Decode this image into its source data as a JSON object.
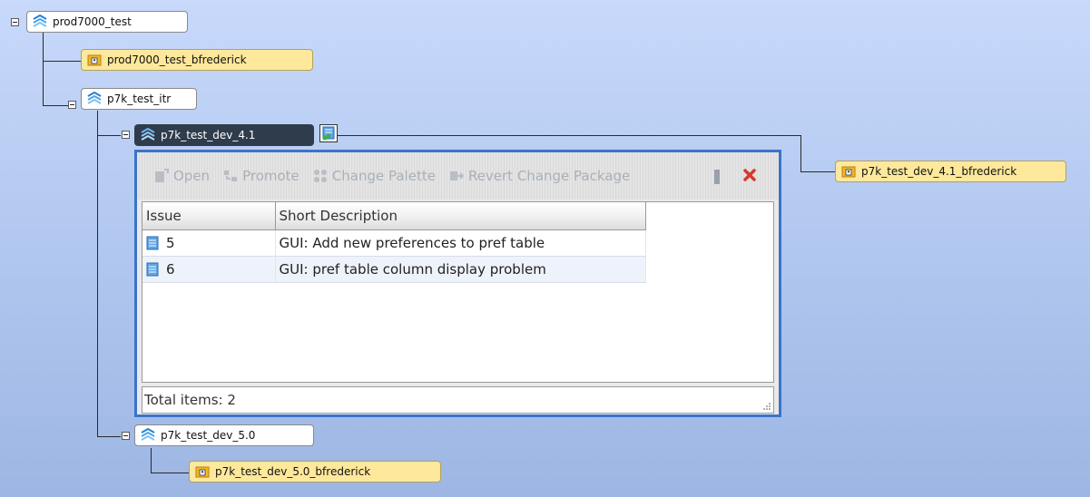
{
  "tree": {
    "nodes": [
      {
        "id": "prod7000_test",
        "label": "prod7000_test",
        "type": "stream"
      },
      {
        "id": "prod7000_test_bfrederick",
        "label": "prod7000_test_bfrederick",
        "type": "sandbox"
      },
      {
        "id": "p7k_test_itr",
        "label": "p7k_test_itr",
        "type": "stream"
      },
      {
        "id": "p7k_test_dev_4.1",
        "label": "p7k_test_dev_4.1",
        "type": "stream",
        "selected": true
      },
      {
        "id": "p7k_test_dev_4.1_bfrederick",
        "label": "p7k_test_dev_4.1_bfrederick",
        "type": "sandbox"
      },
      {
        "id": "p7k_test_dev_5.0",
        "label": "p7k_test_dev_5.0",
        "type": "stream"
      },
      {
        "id": "p7k_test_dev_5.0_bfrederick",
        "label": "p7k_test_dev_5.0_bfrederick",
        "type": "sandbox"
      }
    ]
  },
  "popup": {
    "toolbar": {
      "open": "Open",
      "promote": "Promote",
      "change_palette": "Change Palette",
      "revert": "Revert Change Package",
      "close_icon": "close-icon"
    },
    "columns": [
      "Issue",
      "Short Description"
    ],
    "rows": [
      {
        "issue": "5",
        "description": "GUI: Add new preferences to pref table"
      },
      {
        "issue": "6",
        "description": "GUI: pref table column display problem"
      }
    ],
    "footer": "Total items: 2"
  },
  "colors": {
    "selected_node": "#2f3c4c",
    "sandbox_node": "#fde89b",
    "popup_border": "#3b73c9",
    "toolbar_disabled_text": "#aab0b8",
    "close_red": "#d63a2a"
  }
}
